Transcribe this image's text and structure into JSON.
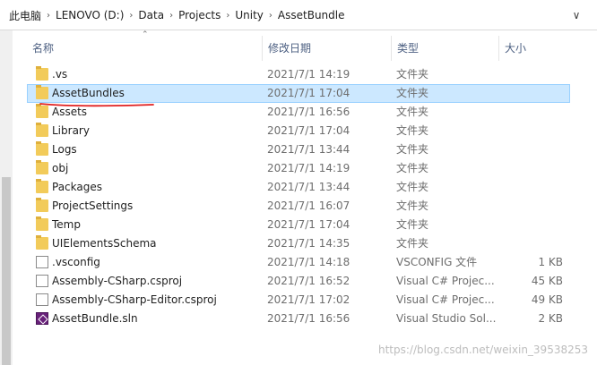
{
  "address": {
    "segments": [
      "此电脑",
      "LENOVO (D:)",
      "Data",
      "Projects",
      "Unity",
      "AssetBundle"
    ]
  },
  "columns": {
    "name": "名称",
    "date": "修改日期",
    "type": "类型",
    "size": "大小"
  },
  "rows": [
    {
      "icon": "folder-icon",
      "name": ".vs",
      "date": "2021/7/1 14:19",
      "type": "文件夹",
      "size": ""
    },
    {
      "icon": "folder-icon",
      "name": "AssetBundles",
      "date": "2021/7/1 17:04",
      "type": "文件夹",
      "size": ""
    },
    {
      "icon": "folder-icon",
      "name": "Assets",
      "date": "2021/7/1 16:56",
      "type": "文件夹",
      "size": ""
    },
    {
      "icon": "folder-icon",
      "name": "Library",
      "date": "2021/7/1 17:04",
      "type": "文件夹",
      "size": ""
    },
    {
      "icon": "folder-icon",
      "name": "Logs",
      "date": "2021/7/1 13:44",
      "type": "文件夹",
      "size": ""
    },
    {
      "icon": "folder-icon",
      "name": "obj",
      "date": "2021/7/1 14:19",
      "type": "文件夹",
      "size": ""
    },
    {
      "icon": "folder-icon",
      "name": "Packages",
      "date": "2021/7/1 13:44",
      "type": "文件夹",
      "size": ""
    },
    {
      "icon": "folder-icon",
      "name": "ProjectSettings",
      "date": "2021/7/1 16:07",
      "type": "文件夹",
      "size": ""
    },
    {
      "icon": "folder-icon",
      "name": "Temp",
      "date": "2021/7/1 17:04",
      "type": "文件夹",
      "size": ""
    },
    {
      "icon": "folder-icon",
      "name": "UIElementsSchema",
      "date": "2021/7/1 14:35",
      "type": "文件夹",
      "size": ""
    },
    {
      "icon": "file-icon",
      "name": ".vsconfig",
      "date": "2021/7/1 14:18",
      "type": "VSCONFIG 文件",
      "size": "1 KB"
    },
    {
      "icon": "file-icon",
      "name": "Assembly-CSharp.csproj",
      "date": "2021/7/1 16:52",
      "type": "Visual C# Projec...",
      "size": "45 KB"
    },
    {
      "icon": "file-icon",
      "name": "Assembly-CSharp-Editor.csproj",
      "date": "2021/7/1 17:02",
      "type": "Visual C# Projec...",
      "size": "49 KB"
    },
    {
      "icon": "visual-studio-icon",
      "name": "AssetBundle.sln",
      "date": "2021/7/1 16:56",
      "type": "Visual Studio Sol...",
      "size": "2 KB"
    }
  ],
  "selected_row": "AssetBundles",
  "watermark": "https://blog.csdn.net/weixin_39538253",
  "colors": {
    "selection": "#cce8ff",
    "folder": "#f2cb5a",
    "annotation": "#e02020"
  }
}
